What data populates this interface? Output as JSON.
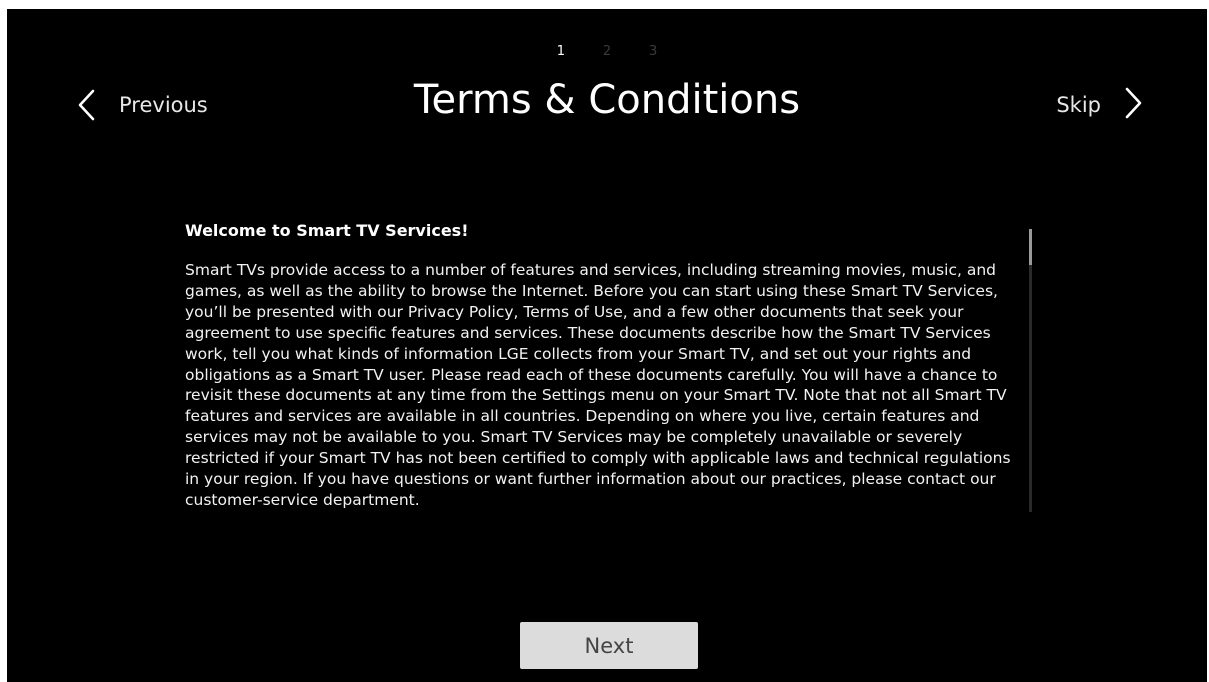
{
  "steps": {
    "items": [
      "1",
      "2",
      "3"
    ],
    "current": 1
  },
  "header": {
    "previous_label": "Previous",
    "title": "Terms & Conditions",
    "skip_label": "Skip"
  },
  "document": {
    "heading": "Welcome to Smart TV Services!",
    "body": "Smart TVs provide access to a number of features and services, including streaming movies, music, and games, as well as the ability to browse the Internet. Before you can start using these Smart TV Services, you’ll be presented with our Privacy Policy, Terms of Use, and a few other documents that seek your agreement to use specific features and services. These documents describe how the Smart TV Services work, tell you what kinds of information LGE collects from your Smart TV, and set out your rights and obligations as a Smart TV user. Please read each of these documents carefully. You will have a chance to revisit these documents at any time from the Settings menu on your Smart TV. Note that not all Smart TV features and services are available in all countries. Depending on where you live, certain features and services may not be available to you. Smart TV Services may be completely unavailable or severely restricted if your Smart TV has not been certified to comply with applicable laws and technical regulations in your region. If you have questions or want further information about our practices, please contact our customer-service department."
  },
  "footer": {
    "next_label": "Next"
  },
  "icons": {
    "previous": "chevron-left-icon",
    "skip": "chevron-right-icon"
  },
  "colors": {
    "background": "#000000",
    "text": "#ffffff",
    "inactive_step": "#3a3a3a",
    "button_bg": "#dcdcdc",
    "button_text": "#444444"
  }
}
